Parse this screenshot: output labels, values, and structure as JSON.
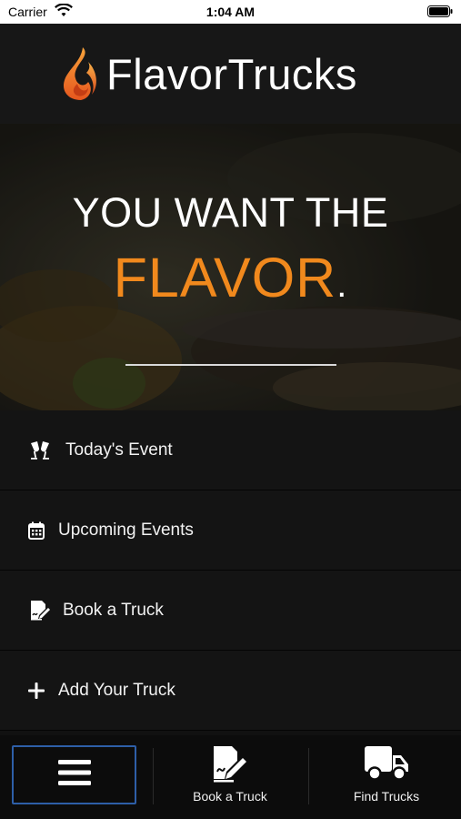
{
  "status_bar": {
    "carrier": "Carrier",
    "time": "1:04 AM"
  },
  "header": {
    "brand": "FlavorTrucks"
  },
  "hero": {
    "line1": "YOU WANT THE",
    "accent": "FLAVOR",
    "punctuation": "."
  },
  "menu": {
    "items": [
      {
        "label": "Today's Event",
        "icon": "cheers-icon"
      },
      {
        "label": "Upcoming Events",
        "icon": "calendar-icon"
      },
      {
        "label": "Book a Truck",
        "icon": "contract-sign-icon"
      },
      {
        "label": "Add Your Truck",
        "icon": "plus-icon"
      }
    ]
  },
  "tab_bar": {
    "menu_icon": "hamburger-icon",
    "book_label": "Book a Truck",
    "find_label": "Find Trucks"
  },
  "colors": {
    "accent": "#f1891d",
    "background": "#111111",
    "focus_border": "#2e5fa8"
  }
}
